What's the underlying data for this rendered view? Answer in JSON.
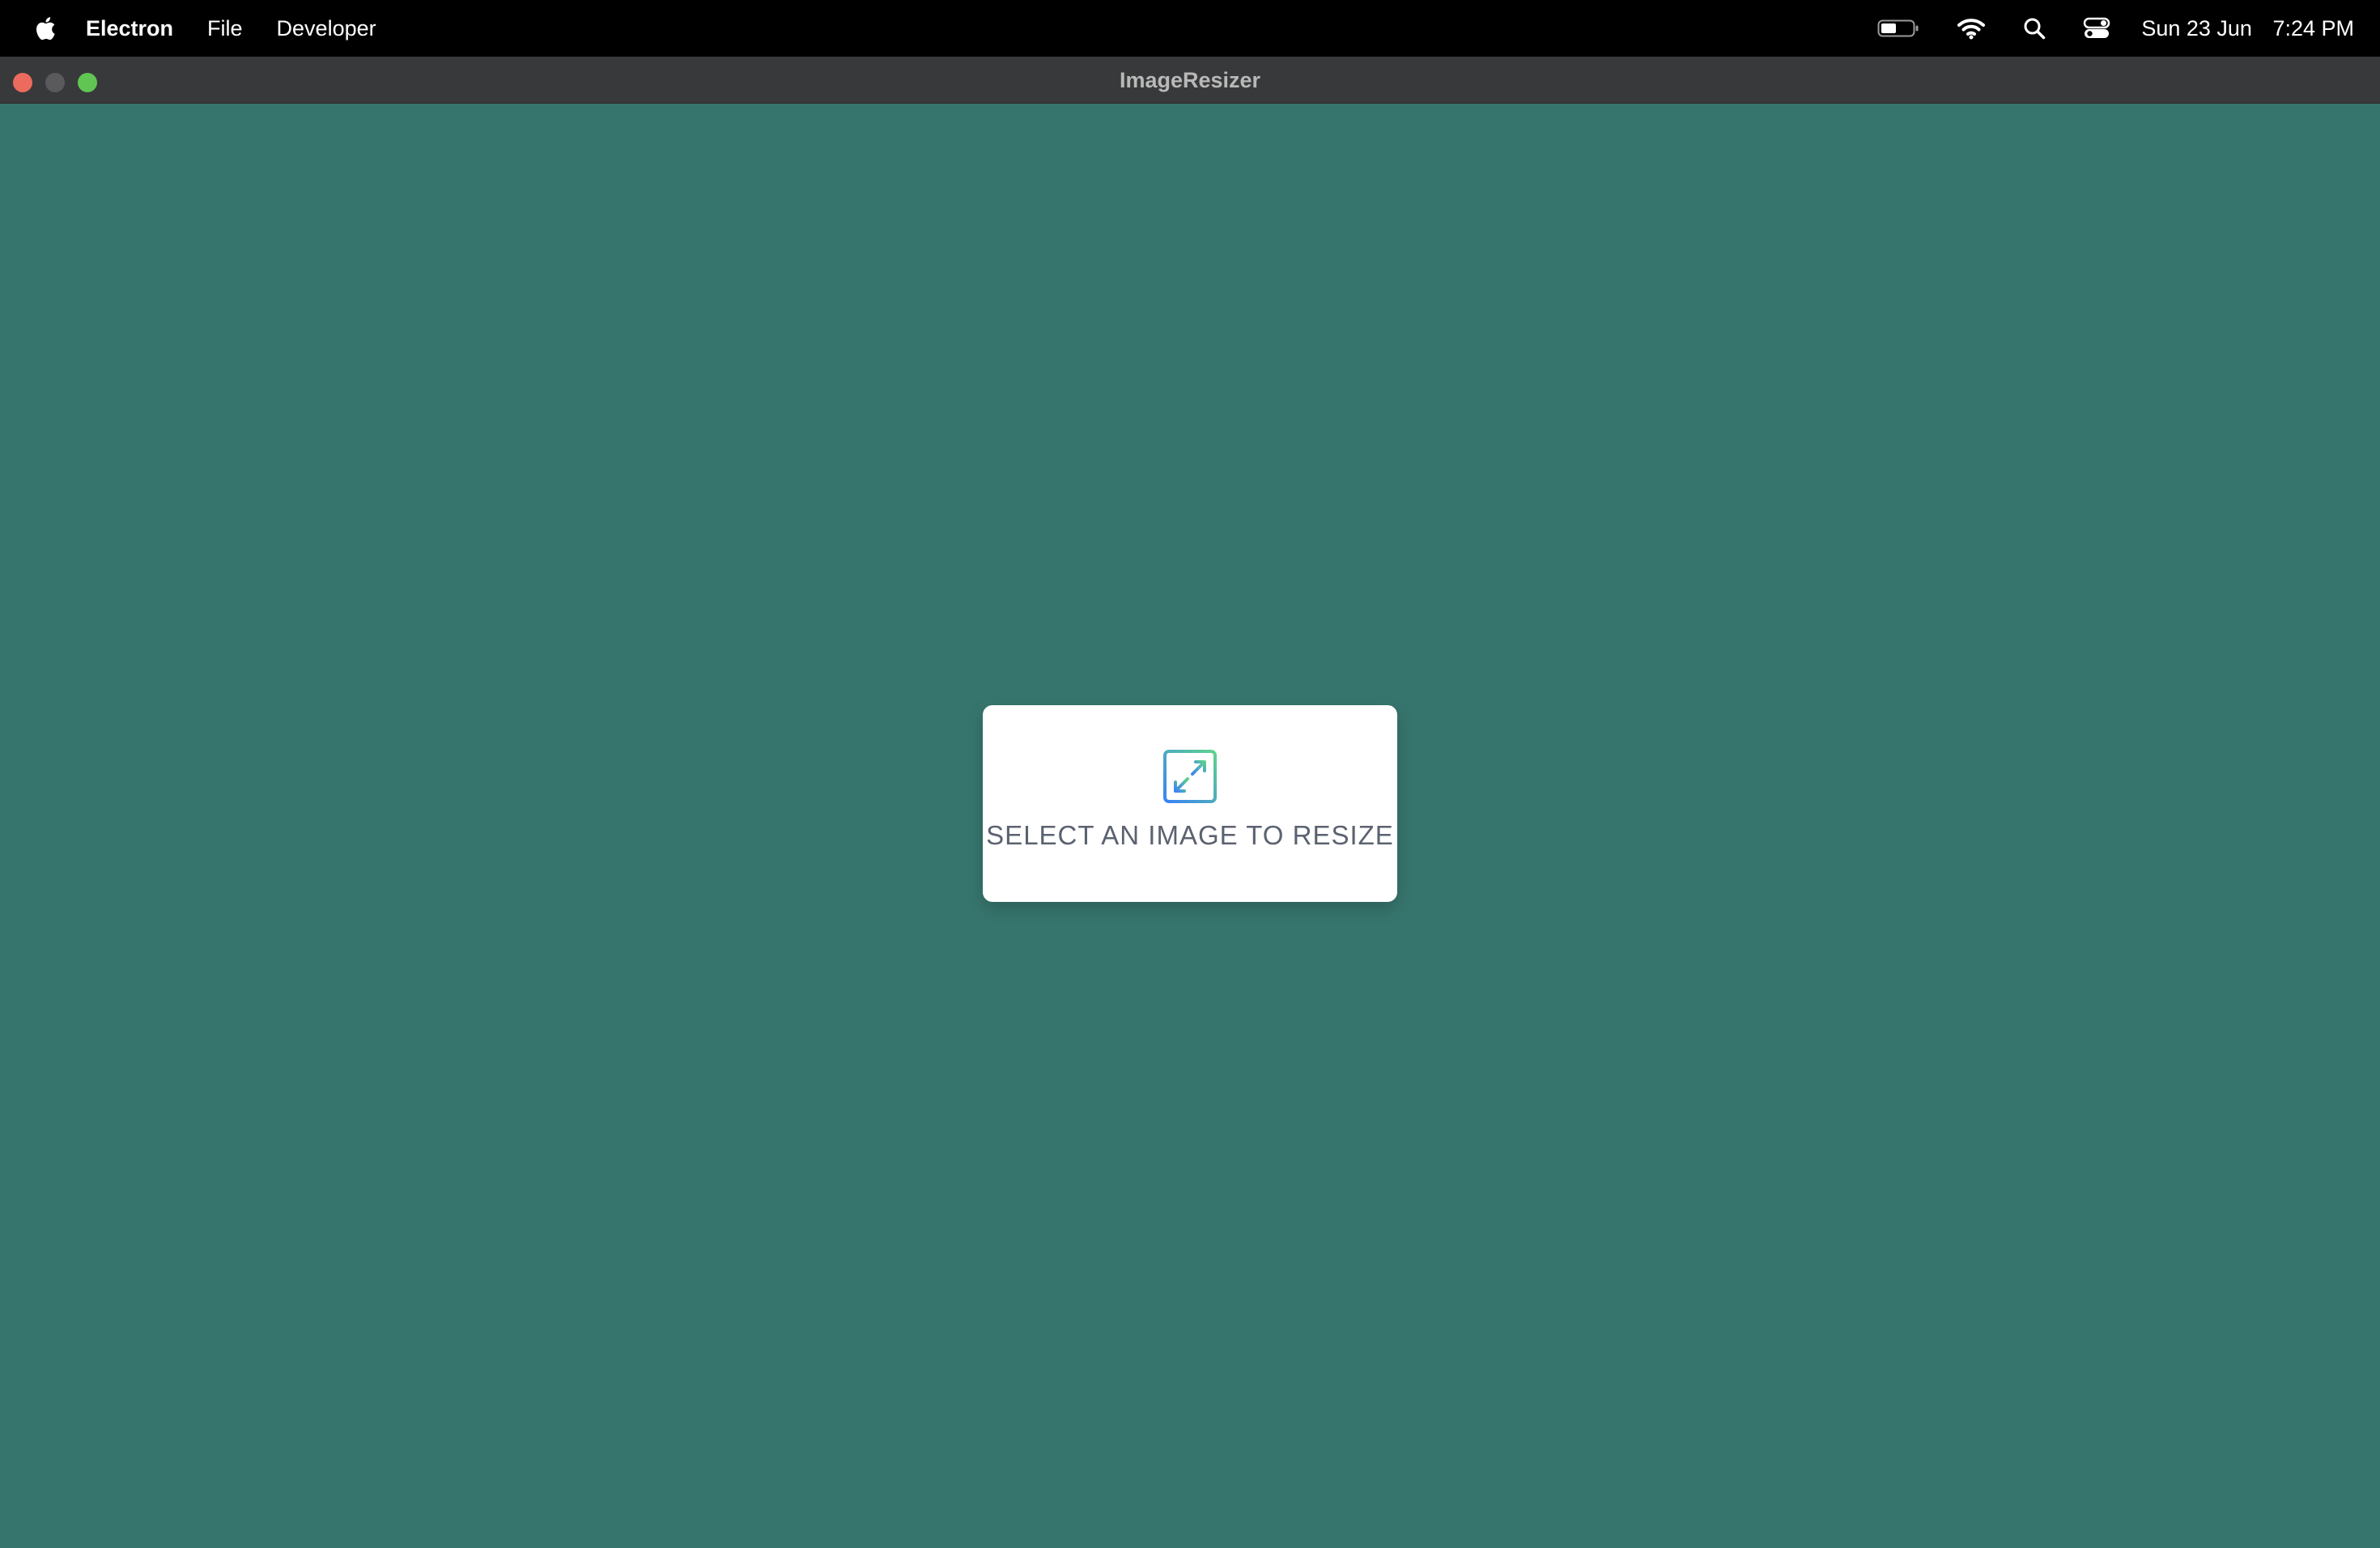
{
  "menubar": {
    "apple_icon": "apple-logo-icon",
    "items": [
      {
        "label": "Electron"
      },
      {
        "label": "File"
      },
      {
        "label": "Developer"
      }
    ],
    "status": {
      "battery_icon": "battery-icon",
      "wifi_icon": "wifi-icon",
      "search_icon": "search-icon",
      "control_center_icon": "control-center-icon",
      "date": "Sun 23 Jun",
      "time": "7:24 PM"
    }
  },
  "window": {
    "title": "ImageResizer"
  },
  "main": {
    "select_prompt": "SELECT AN IMAGE TO RESIZE",
    "resize_icon": "resize-expand-icon"
  },
  "colors": {
    "background": "#36756d",
    "menubar": "#000000",
    "titlebar": "#38393a",
    "card": "#ffffff",
    "prompt_text": "#5b6270",
    "close": "#ed6a5e",
    "minimize": "#5a5a5c",
    "maximize": "#61c554",
    "icon_gradient_start": "#5fd38d",
    "icon_gradient_end": "#3b82f6"
  }
}
